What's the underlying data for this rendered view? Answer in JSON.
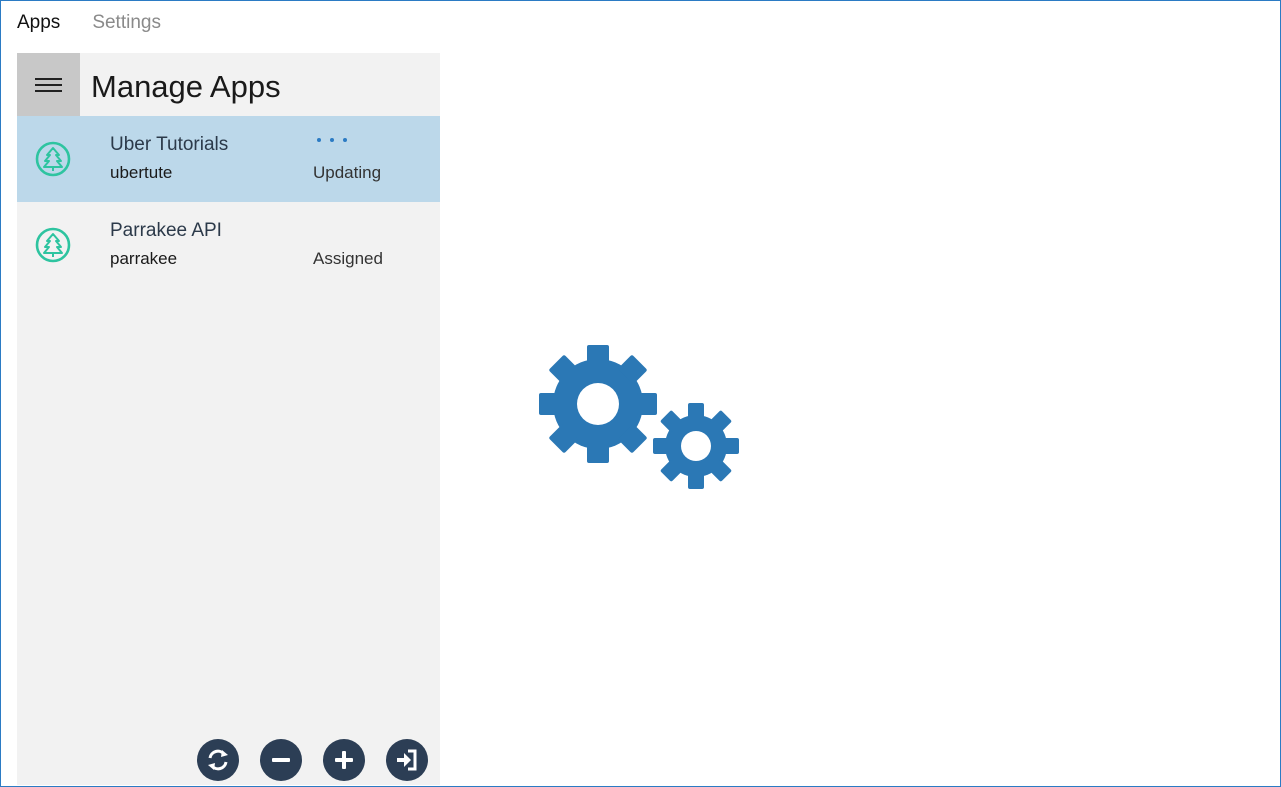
{
  "nav": {
    "tabs": [
      {
        "label": "Apps",
        "active": true
      },
      {
        "label": "Settings",
        "active": false
      }
    ]
  },
  "sidebar": {
    "title": "Manage Apps",
    "menu_icon": "hamburger-icon",
    "apps": [
      {
        "name": "Uber Tutorials",
        "slug": "ubertute",
        "status": "Updating",
        "selected": true,
        "icon": "tree-icon"
      },
      {
        "name": "Parrakee API",
        "slug": "parrakee",
        "status": "Assigned",
        "selected": false,
        "icon": "tree-icon"
      }
    ],
    "commands": [
      {
        "name": "refresh",
        "icon": "refresh-icon"
      },
      {
        "name": "remove",
        "icon": "minus-icon"
      },
      {
        "name": "add",
        "icon": "plus-icon"
      },
      {
        "name": "sign-in",
        "icon": "sign-in-icon"
      }
    ]
  },
  "colors": {
    "accent": "#2b7bc4",
    "selected_row": "#bcd8ea",
    "panel_bg": "#f2f2f2",
    "app_icon": "#2ec4a0",
    "command_button": "#2c3e55",
    "gear": "#2b78b5"
  },
  "illustration": {
    "icon": "gears-icon"
  }
}
